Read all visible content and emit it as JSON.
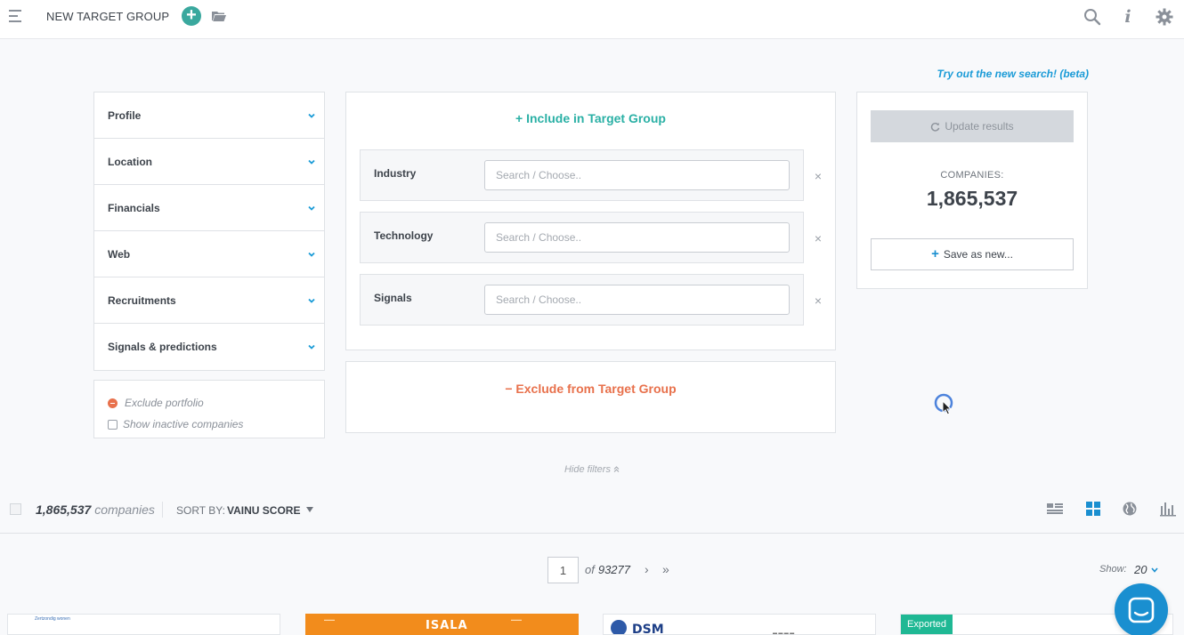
{
  "header": {
    "title": "NEW TARGET GROUP",
    "add_label": "+"
  },
  "beta_link": "Try out the new search! (beta)",
  "filters": {
    "items": [
      {
        "label": "Profile"
      },
      {
        "label": "Location"
      },
      {
        "label": "Financials"
      },
      {
        "label": "Web"
      },
      {
        "label": "Recruitments"
      },
      {
        "label": "Signals & predictions"
      }
    ],
    "exclude_portfolio": "Exclude portfolio",
    "show_inactive": "Show inactive companies"
  },
  "include": {
    "title": "+ Include in Target Group",
    "criteria": [
      {
        "label": "Industry",
        "placeholder": "Search / Choose.."
      },
      {
        "label": "Technology",
        "placeholder": "Search / Choose.."
      },
      {
        "label": "Signals",
        "placeholder": "Search / Choose.."
      }
    ],
    "remove_symbol": "×"
  },
  "exclude": {
    "title": "− Exclude from Target Group"
  },
  "results": {
    "update_label": "Update results",
    "companies_label": "COMPANIES:",
    "companies_count": "1,865,537",
    "save_plus": "+",
    "save_label": "Save as new..."
  },
  "hide_filters": "Hide filters",
  "results_bar": {
    "count": "1,865,537",
    "count_unit": "companies",
    "sort_label": "SORT BY:",
    "sort_value": "VAINU SCORE"
  },
  "pagination": {
    "current_page": "1",
    "of_label": "of",
    "total_pages": "93277",
    "next": "›",
    "last": "»",
    "show_label": "Show:",
    "show_value": "20"
  },
  "cards": {
    "card1_text": "Zertzondig wonen",
    "card2_brand": "ISALA",
    "card3_brand": "DSM",
    "exported_badge": "Exported"
  },
  "colors": {
    "accent_teal": "#2ab0a5",
    "exclude_orange": "#e8714c",
    "link_blue": "#1a9bd7",
    "chat_blue": "#1a8fd0",
    "exported_green": "#1fb894"
  }
}
